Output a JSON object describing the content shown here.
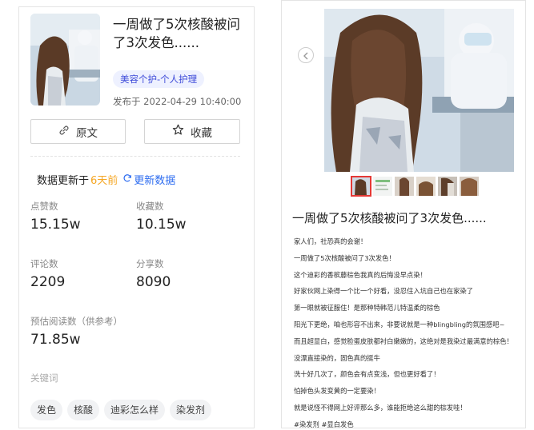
{
  "left": {
    "title": "一周做了5次核酸被问了3次发色......",
    "tag": "美容个护-个人护理",
    "publish_prefix": "发布于",
    "publish_time": "2022-04-29 10:40:00",
    "btn_original": "原文",
    "btn_favorite": "收藏",
    "update_prefix": "数据更新于",
    "update_ago": "6天前",
    "refresh_label": "更新数据",
    "stats": {
      "likes_label": "点赞数",
      "likes": "15.15w",
      "favs_label": "收藏数",
      "favs": "10.15w",
      "comments_label": "评论数",
      "comments": "2209",
      "shares_label": "分享数",
      "shares": "8090",
      "reads_label": "预估阅读数（供参考）",
      "reads": "71.85w"
    },
    "keywords_label": "关键词",
    "keywords": [
      "发色",
      "核酸",
      "迪彩怎么样",
      "染发剂"
    ]
  },
  "right": {
    "title": "一周做了5次核酸被问了3次发色......",
    "lines": [
      "家人们，社恐真的会谢！",
      "一周做了5次核酸被问了3次发色！",
      "这个迪彩的香槟藤棕色我真的后悔没早点染！",
      "好家伙网上染得一个比一个好看，没忍住入坑自己也在家染了",
      "第一眼就被征服住！是那种特韩范儿特温柔的棕色",
      "阳光下更绝，咱也形容不出来，非要说就是一种blingbling的氛围感吧~",
      "而且超显白，感觉脸蛋皮肤都衬白嫩嫩的，这绝对是我染过最满意的棕色！",
      "没漂直接染的，固色真的挺牛",
      "洗十好几次了，颜色会有点变浅，但也更好看了！",
      "怕掉色头发变黄的一定要染！",
      "就是说怪不得网上好评那么多，谁能拒绝这么甜的棕发哇！",
      "#染发剂 #显白发色"
    ]
  },
  "colors": {
    "accent_blue": "#2d6cf0",
    "tag_bg": "#eef1ff",
    "tag_text": "#3e4bd9",
    "ago_orange": "#f5a623",
    "active_thumb": "#e53935"
  }
}
